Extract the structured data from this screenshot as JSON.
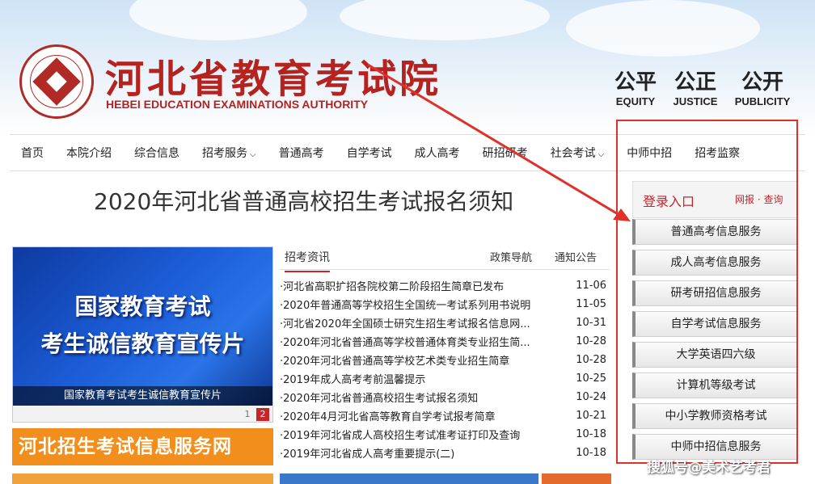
{
  "header": {
    "title": "河北省教育考试院",
    "subtitle": "HEBEI EDUCATION EXAMINATIONS AUTHORITY",
    "mottos": [
      {
        "cn": "公平",
        "en": "EQUITY"
      },
      {
        "cn": "公正",
        "en": "JUSTICE"
      },
      {
        "cn": "公开",
        "en": "PUBLICITY"
      }
    ]
  },
  "nav": {
    "items": [
      {
        "label": "首页",
        "dropdown": false
      },
      {
        "label": "本院介绍",
        "dropdown": false
      },
      {
        "label": "综合信息",
        "dropdown": false
      },
      {
        "label": "招考服务",
        "dropdown": true
      },
      {
        "label": "普通高考",
        "dropdown": false
      },
      {
        "label": "自学考试",
        "dropdown": false
      },
      {
        "label": "成人高考",
        "dropdown": false
      },
      {
        "label": "研招研考",
        "dropdown": false
      },
      {
        "label": "社会考试",
        "dropdown": true
      },
      {
        "label": "中师中招",
        "dropdown": false
      },
      {
        "label": "招考监察",
        "dropdown": false
      }
    ],
    "dropdown_glyph": "⌵"
  },
  "page_title": "2020年河北省普通高校招生考试报名须知",
  "video": {
    "line1": "国家教育考试",
    "line2": "考生诚信教育宣传片",
    "caption": "国家教育考试考生诚信教育宣传片",
    "pages": [
      "1",
      "2"
    ],
    "active_page": 2
  },
  "banner": "河北招生考试信息服务网",
  "news": {
    "tabs": [
      "招考资讯",
      "政策导航",
      "通知公告"
    ],
    "active_tab": 0,
    "items": [
      {
        "title": "·河北省高职扩招各院校第二阶段招生简章已发布",
        "date": "11-06"
      },
      {
        "title": "·2020年普通高等学校招生全国统一考试系列用书说明",
        "date": "11-05"
      },
      {
        "title": "·河北省2020年全国硕士研究生招生考试报名信息网...",
        "date": "10-31"
      },
      {
        "title": "·2020年河北省普通高等学校普通体育类专业招生简...",
        "date": "10-28"
      },
      {
        "title": "·2020年河北省普通高等学校艺术类专业招生简章",
        "date": "10-28"
      },
      {
        "title": "·2019年成人高考考前温馨提示",
        "date": "10-25"
      },
      {
        "title": "·2020年河北省普通高校招生考试报名须知",
        "date": "10-24"
      },
      {
        "title": "·2020年4月河北省高等教育自学考试报考简章",
        "date": "10-21"
      },
      {
        "title": "·2019年河北省成人高校招生考试准考证打印及查询",
        "date": "10-18"
      },
      {
        "title": "·2019年河北省成人高考重要提示(二)",
        "date": "10-18"
      }
    ]
  },
  "login": {
    "title": "登录入口",
    "right": "网报 · 查询"
  },
  "services": [
    "普通高考信息服务",
    "成人高考信息服务",
    "研考研招信息服务",
    "自学考试信息服务",
    "大学英语四六级",
    "计算机等级考试",
    "中小学教师资格考试",
    "中师中招信息服务"
  ],
  "watermark": "搜狐号@美术艺考君",
  "colors": {
    "brand_red": "#b5231f",
    "annotation_red": "#e0302a",
    "orange_banner": "#f28f1c",
    "video_blue": "#1c5dd8"
  }
}
